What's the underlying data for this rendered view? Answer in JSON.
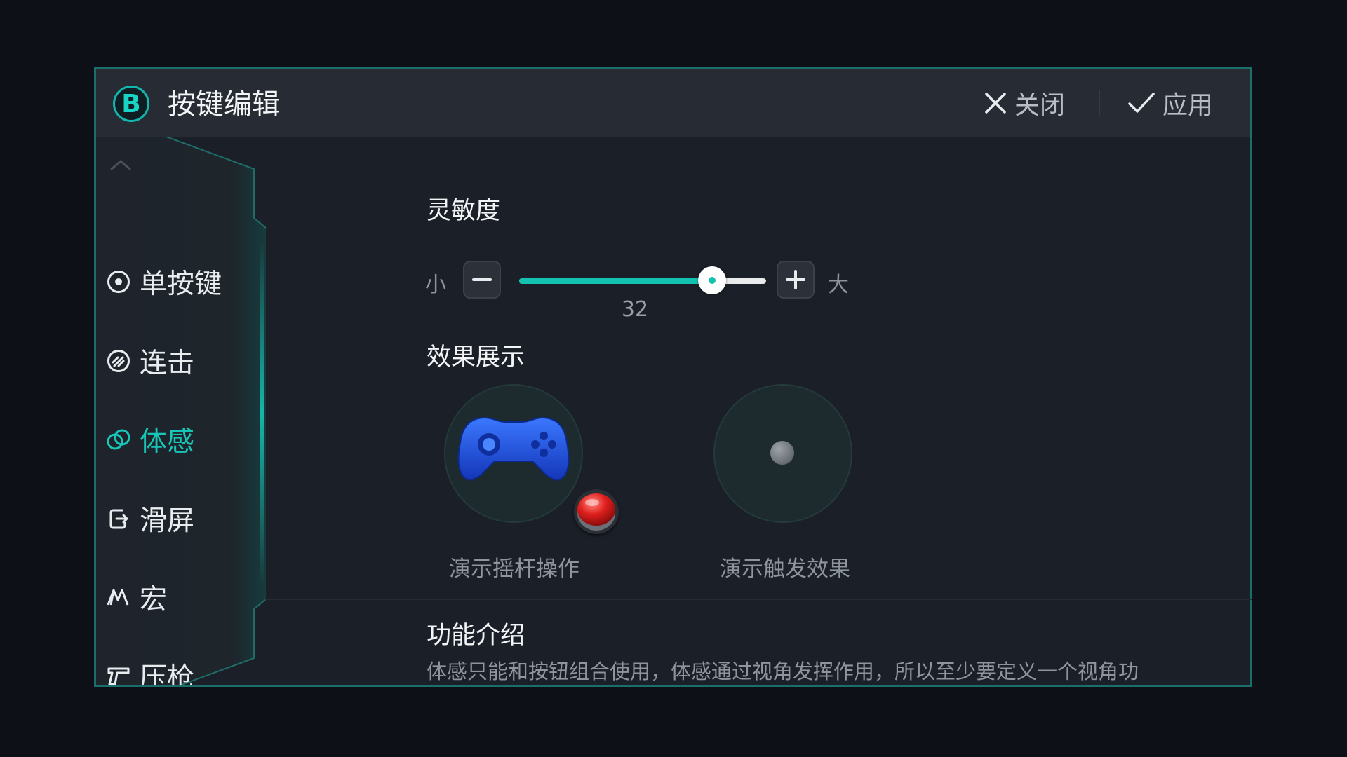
{
  "header": {
    "logo_letter": "B",
    "title": "按键编辑",
    "close_label": "关闭",
    "apply_label": "应用"
  },
  "sidebar": {
    "items": [
      {
        "label": "单按键",
        "icon": "target-circle-icon",
        "active": false
      },
      {
        "label": "连击",
        "icon": "combo-circle-icon",
        "active": false
      },
      {
        "label": "体感",
        "icon": "gyro-rings-icon",
        "active": true
      },
      {
        "label": "滑屏",
        "icon": "swipe-screen-icon",
        "active": false
      },
      {
        "label": "宏",
        "icon": "macro-icon",
        "active": false
      },
      {
        "label": "压枪",
        "icon": "gun-icon",
        "active": false
      }
    ]
  },
  "sensitivity": {
    "title": "灵敏度",
    "min_label": "小",
    "max_label": "大",
    "value": "32",
    "fill_fraction": 0.78
  },
  "demo": {
    "title": "效果展示",
    "joystick_label": "演示摇杆操作",
    "trigger_label": "演示触发效果"
  },
  "intro": {
    "title": "功能介绍",
    "text": "体感只能和按钮组合使用，体感通过视角发挥作用，所以至少要定义一个视角功"
  },
  "colors": {
    "accent": "#13c2b1",
    "background": "#1b1f27",
    "gamepad": "#1e4fd6",
    "red_button": "#e0201e"
  }
}
